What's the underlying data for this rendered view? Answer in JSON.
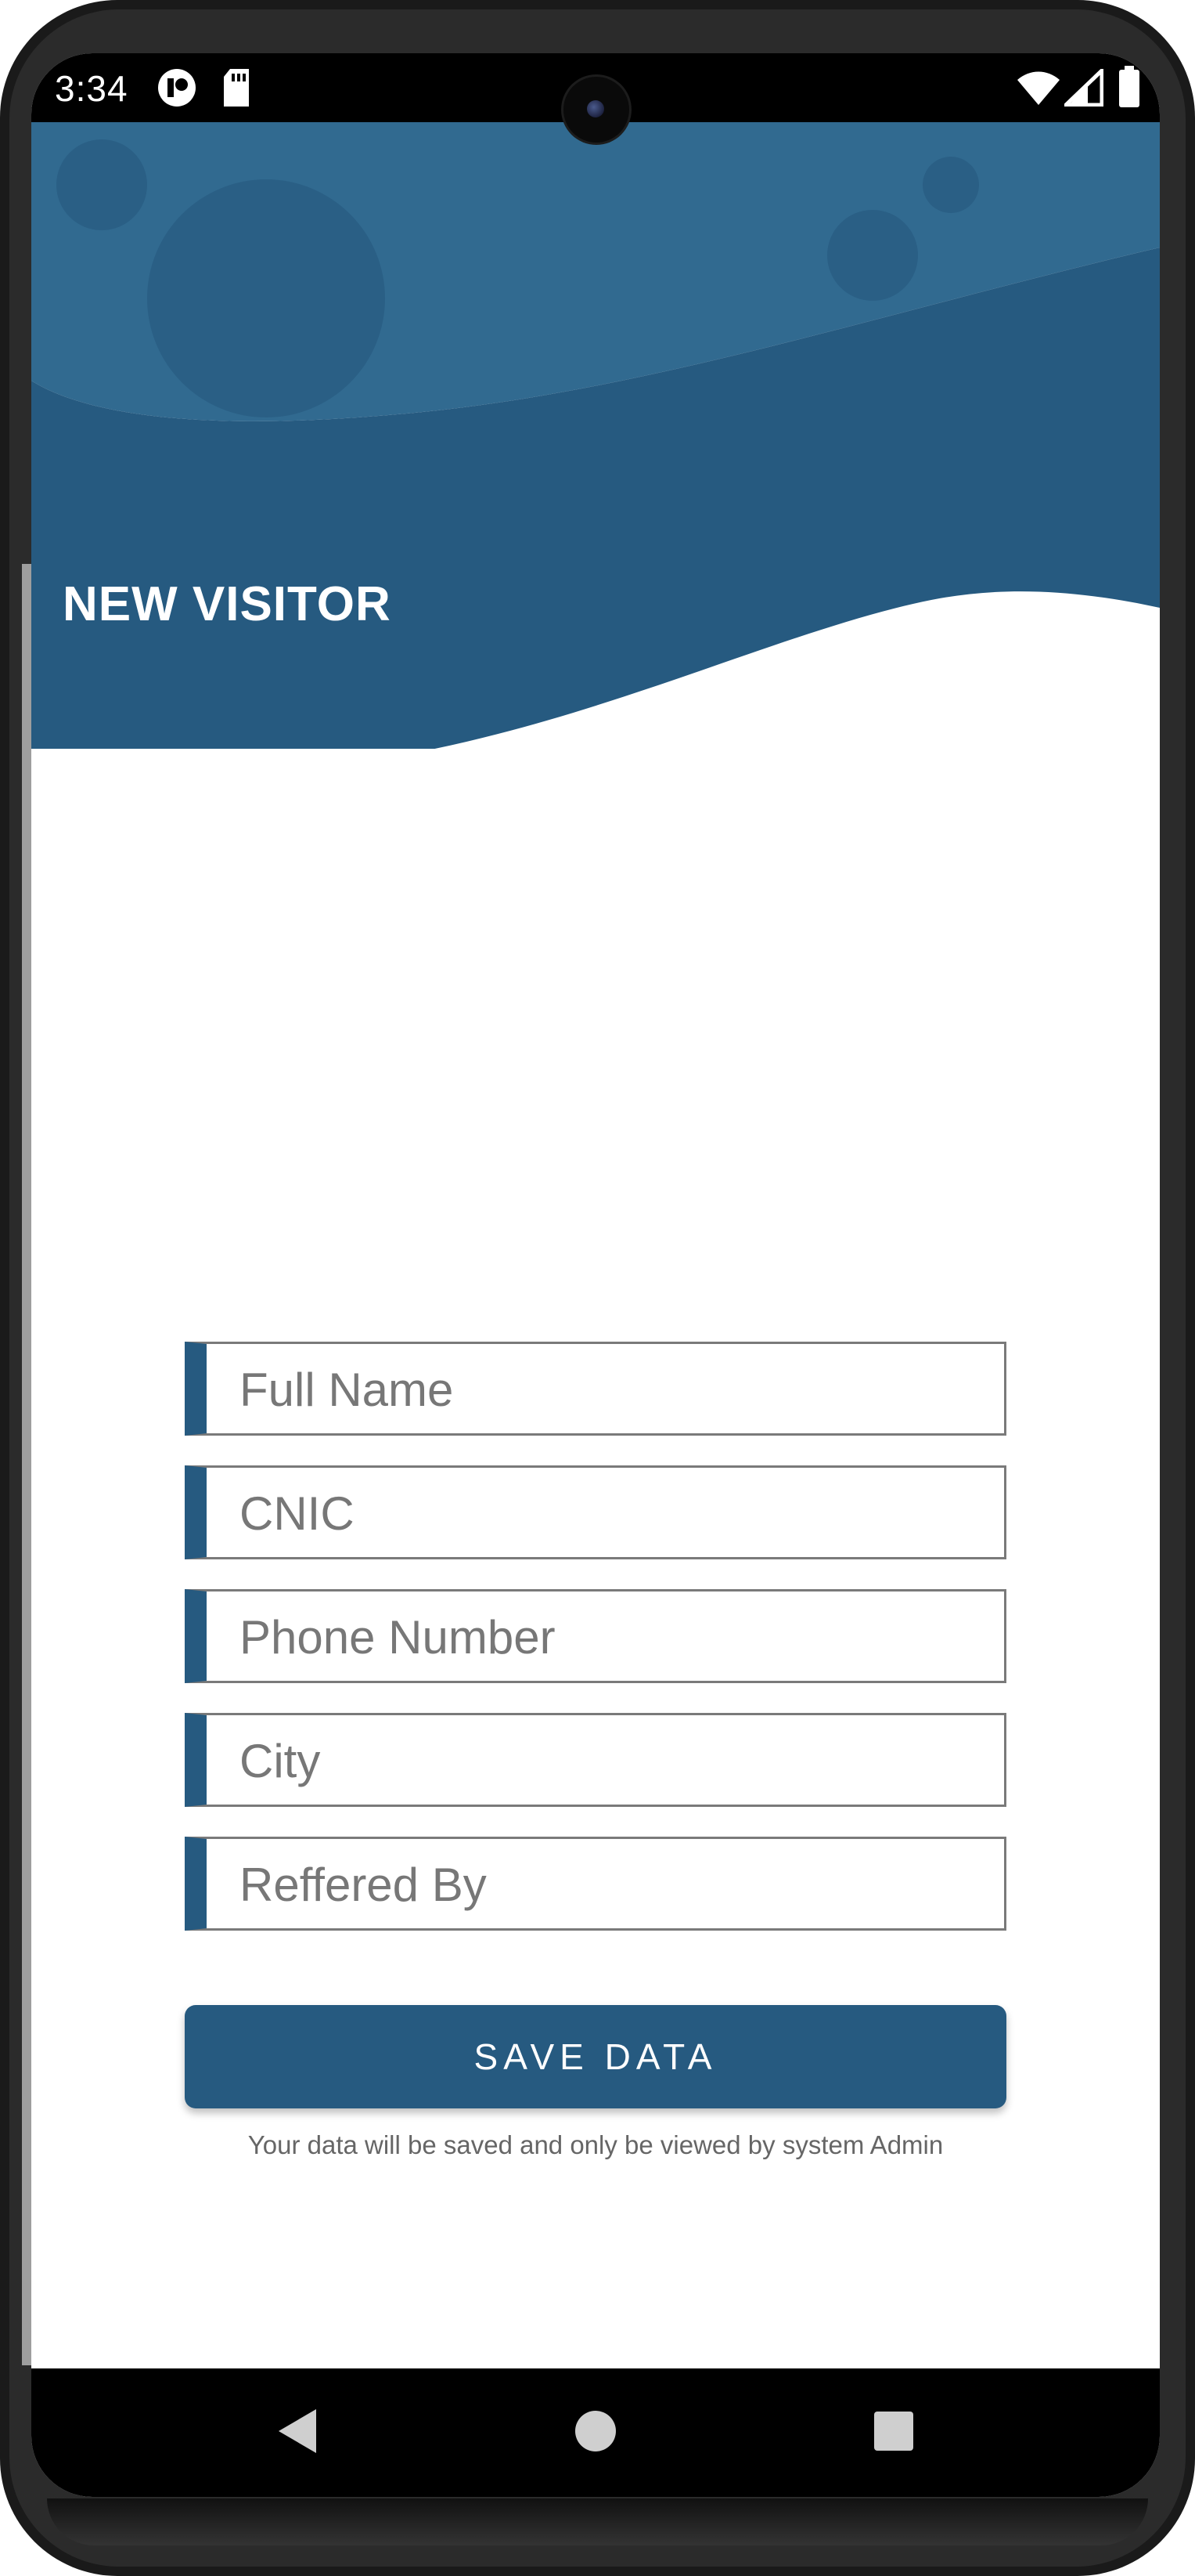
{
  "status_bar": {
    "time": "3:34",
    "icons": [
      "app-notification-icon",
      "sd-card-icon",
      "wifi-icon",
      "signal-icon",
      "battery-icon"
    ]
  },
  "header": {
    "title": "NEW VISITOR",
    "colors": {
      "light_band": "#316a90",
      "dark_band": "#265a80",
      "bubble": "#2a5f85"
    }
  },
  "form": {
    "fields": [
      {
        "placeholder": "Full Name",
        "value": ""
      },
      {
        "placeholder": "CNIC",
        "value": ""
      },
      {
        "placeholder": "Phone Number",
        "value": ""
      },
      {
        "placeholder": "City",
        "value": ""
      },
      {
        "placeholder": "Reffered By",
        "value": ""
      }
    ],
    "accent_color": "#265a80"
  },
  "save_button": {
    "label": "SAVE DATA"
  },
  "footnote": "Your data will be saved and only be viewed by system Admin",
  "nav_bar": {
    "buttons": [
      "back-icon",
      "home-icon",
      "recents-icon"
    ]
  }
}
